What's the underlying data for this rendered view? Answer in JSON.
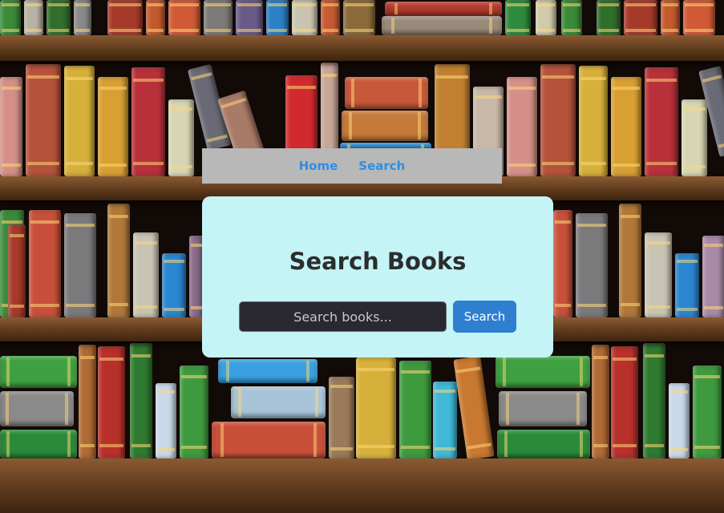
{
  "nav": {
    "links": [
      {
        "label": "Home"
      },
      {
        "label": "Search"
      }
    ]
  },
  "search": {
    "title": "Search Books",
    "placeholder": "Search books...",
    "value": "",
    "button_label": "Search"
  },
  "colors": {
    "nav_background": "#b8b8b8",
    "nav_link": "#2e8ee6",
    "card_background": "#c4f4f6",
    "title_text": "#2d2d2d",
    "input_background": "#2a2830",
    "button_background": "#2f7fd1",
    "shelf_wood": "#6b4424"
  },
  "background": {
    "icon": "bookshelf-image"
  }
}
